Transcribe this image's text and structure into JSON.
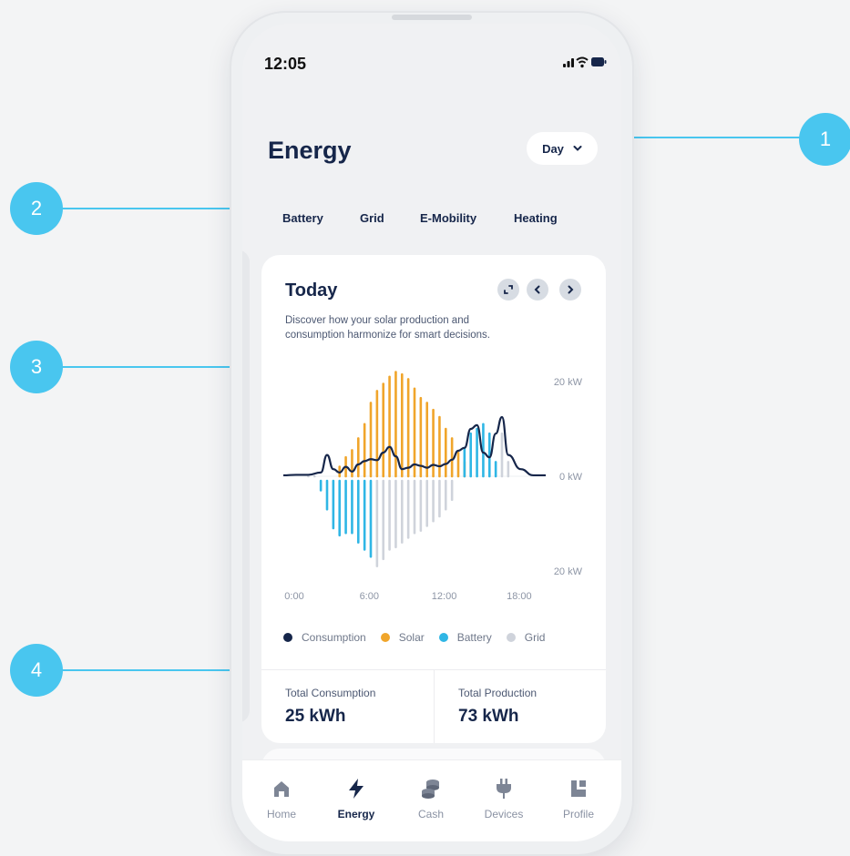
{
  "annotations": [
    "1",
    "2",
    "3",
    "4"
  ],
  "status_bar": {
    "time": "12:05",
    "icons": [
      "signal-icon",
      "wifi-icon",
      "battery-icon"
    ]
  },
  "header": {
    "title": "Energy",
    "period_select": {
      "value": "Day"
    }
  },
  "tabs": [
    {
      "label": "Battery"
    },
    {
      "label": "Grid"
    },
    {
      "label": "E-Mobility"
    },
    {
      "label": "Heating"
    }
  ],
  "card": {
    "title": "Today",
    "description": "Discover how your solar production and consumption harmonize for smart decisions.",
    "buttons": [
      "expand-icon",
      "chevron-left-icon",
      "chevron-right-icon"
    ]
  },
  "chart_data": {
    "type": "bar",
    "y_tick_labels": [
      "20 kW",
      "0 kW",
      "20 kW"
    ],
    "x_tick_labels": [
      "0:00",
      "6:00",
      "12:00",
      "18:00"
    ],
    "ylim": [
      -20,
      20
    ],
    "legend_position": "bottom",
    "series": [
      {
        "name": "Consumption",
        "type": "line",
        "color": "#16264a",
        "x": [
          0,
          1,
          2,
          3,
          3.5,
          4,
          4.5,
          5,
          5.5,
          6,
          6.5,
          7,
          7.5,
          8,
          8.5,
          9,
          9.5,
          10,
          10.5,
          11,
          11.5,
          12,
          12.5,
          13,
          13.5,
          14,
          14.5,
          15,
          15.5,
          16,
          16.5,
          17,
          17.5,
          18,
          19,
          20,
          21
        ],
        "values": [
          0.2,
          0.3,
          0.3,
          0.8,
          4.5,
          1.5,
          0.8,
          2.0,
          1.0,
          2.5,
          3.2,
          3.6,
          3.4,
          5.0,
          6.2,
          4.2,
          1.5,
          1.8,
          2.5,
          2.2,
          1.8,
          2.4,
          2.1,
          2.6,
          3.5,
          5.4,
          6.0,
          10.0,
          10.8,
          5.0,
          4.0,
          9.0,
          12.5,
          4.5,
          1.5,
          0.2,
          0.2
        ]
      },
      {
        "name": "Solar",
        "color": "#f0a52b",
        "x": [
          4.5,
          5,
          5.5,
          6,
          6.5,
          7,
          7.5,
          8,
          8.5,
          9,
          9.5,
          10,
          10.5,
          11,
          11.5,
          12,
          12.5,
          13,
          13.5,
          14,
          14.5
        ],
        "values": [
          2,
          4,
          5.5,
          8,
          11,
          15.5,
          18,
          19.5,
          21,
          22,
          21.5,
          20.5,
          18.5,
          16.5,
          15.5,
          14,
          12.5,
          10,
          8,
          5,
          3
        ]
      },
      {
        "name": "Battery",
        "color": "#2fb6e5",
        "x": [
          3,
          3.5,
          4,
          4.5,
          5,
          5.5,
          6,
          6.5,
          7,
          14.5,
          15,
          15.5,
          16,
          16.5,
          17
        ],
        "values": [
          -2,
          -6,
          -10,
          -11.5,
          -11,
          -11,
          -13,
          -14.5,
          -16,
          6,
          9,
          10,
          11,
          9,
          3
        ]
      },
      {
        "name": "Grid",
        "color": "#cfd3db",
        "x": [
          2,
          2.5,
          7.5,
          8,
          8.5,
          9,
          9.5,
          10,
          10.5,
          11,
          11.5,
          12,
          12.5,
          13,
          13.5,
          17.5,
          18
        ],
        "values": [
          0,
          0,
          -18,
          -16.5,
          -14.5,
          -14,
          -13,
          -12,
          -11,
          -10.5,
          -9.5,
          -8.5,
          -7.5,
          -6,
          -4,
          9,
          3
        ]
      }
    ]
  },
  "legend": [
    {
      "name": "Consumption",
      "color": "#16264a"
    },
    {
      "name": "Solar",
      "color": "#f0a52b"
    },
    {
      "name": "Battery",
      "color": "#2fb6e5"
    },
    {
      "name": "Grid",
      "color": "#cfd3db"
    }
  ],
  "totals": {
    "consumption": {
      "label": "Total Consumption",
      "value": "25 kWh"
    },
    "production": {
      "label": "Total Production",
      "value": "73 kWh"
    }
  },
  "bottom_nav": [
    {
      "label": "Home",
      "icon": "home-icon",
      "active": false
    },
    {
      "label": "Energy",
      "icon": "lightning-icon",
      "active": true
    },
    {
      "label": "Cash",
      "icon": "coins-icon",
      "active": false
    },
    {
      "label": "Devices",
      "icon": "plug-icon",
      "active": false
    },
    {
      "label": "Profile",
      "icon": "profile-icon",
      "active": false
    }
  ]
}
